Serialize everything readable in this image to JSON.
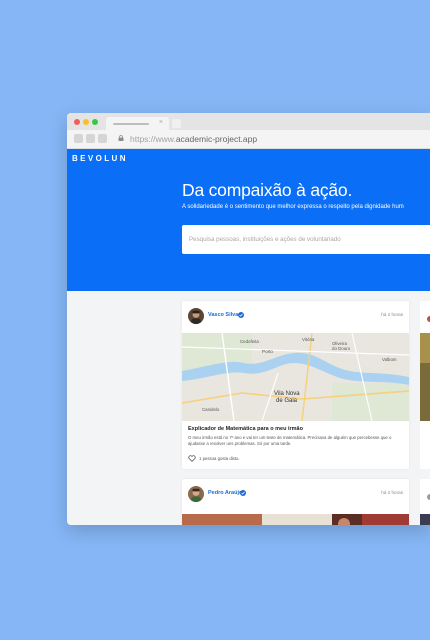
{
  "browser": {
    "url_scheme": "https://www.",
    "url_host": "academic-project.app",
    "tab_close": "×"
  },
  "brand": "BEVOLUN",
  "hero": {
    "title": "Da compaixão à ação.",
    "subtitle": "A solidariedade é o sentimento que melhor expressa o respeito pela dignidade hum",
    "search_placeholder": "Pesquisa pessoas, instituições e ações de voluntariado"
  },
  "posts": [
    {
      "author": "Vasco Silva",
      "time": "há 2 horas",
      "title": "Explicador de Matemática para o meu irmão",
      "description": "O meu irmão está no 7º ano e vai ter um teste de matemática. Precisava de alguém que percebesse que o ajudasse a resolver uns problemas. Só por uma tarde.",
      "likes": "1 pessoa gosta disto.",
      "map_labels": {
        "city1": "Porto",
        "city2": "Vila Nova",
        "city3": "de Gaia",
        "city4": "Valbom",
        "city5": "Oliveira",
        "city6": "do Douro",
        "city7": "Canidelo",
        "city8": "Vitória",
        "city9": "Cedofeita"
      }
    },
    {
      "author": "Pedro Araújo",
      "time": "há 2 horas"
    }
  ],
  "colors": {
    "accent": "#0a6ef7",
    "link": "#1d6ad6",
    "page_bg": "#86b6f6"
  }
}
